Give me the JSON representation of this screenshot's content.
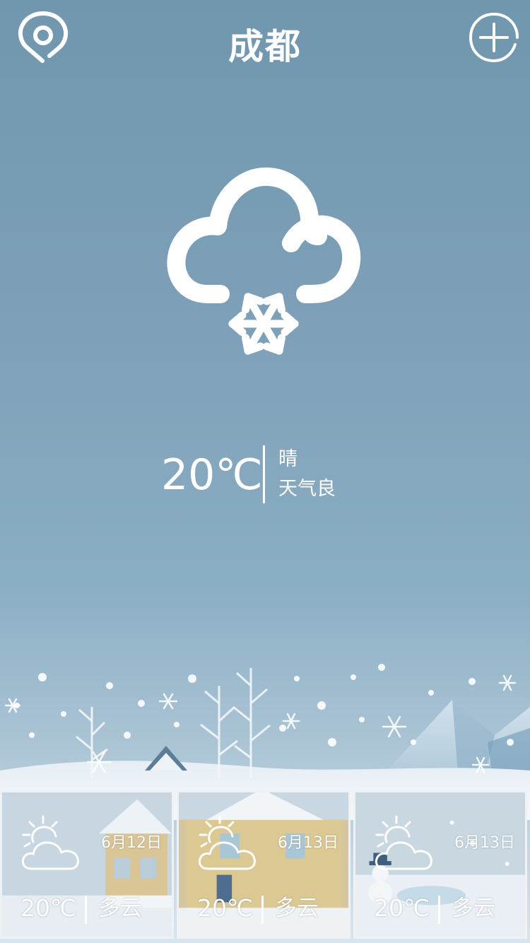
{
  "header": {
    "city": "成都",
    "location_icon": "map-pin-icon",
    "add_icon": "plus-circle-icon"
  },
  "current": {
    "icon": "snow-cloud-icon",
    "temperature": "20℃",
    "condition": "晴",
    "air_quality": "天气良"
  },
  "scene": {
    "icon": "winter-snow-illustration"
  },
  "forecast": [
    {
      "date": "6月12日",
      "temperature": "20℃",
      "condition": "多云",
      "icon": "partly-cloudy-icon"
    },
    {
      "date": "6月13日",
      "temperature": "20℃",
      "condition": "多云",
      "icon": "partly-cloudy-icon"
    },
    {
      "date": "6月13日",
      "temperature": "20℃",
      "condition": "多云",
      "icon": "partly-cloudy-icon"
    }
  ],
  "colors": {
    "background_top": "#7097ae",
    "background_bottom": "#d8e5ee",
    "text": "#ffffff"
  }
}
